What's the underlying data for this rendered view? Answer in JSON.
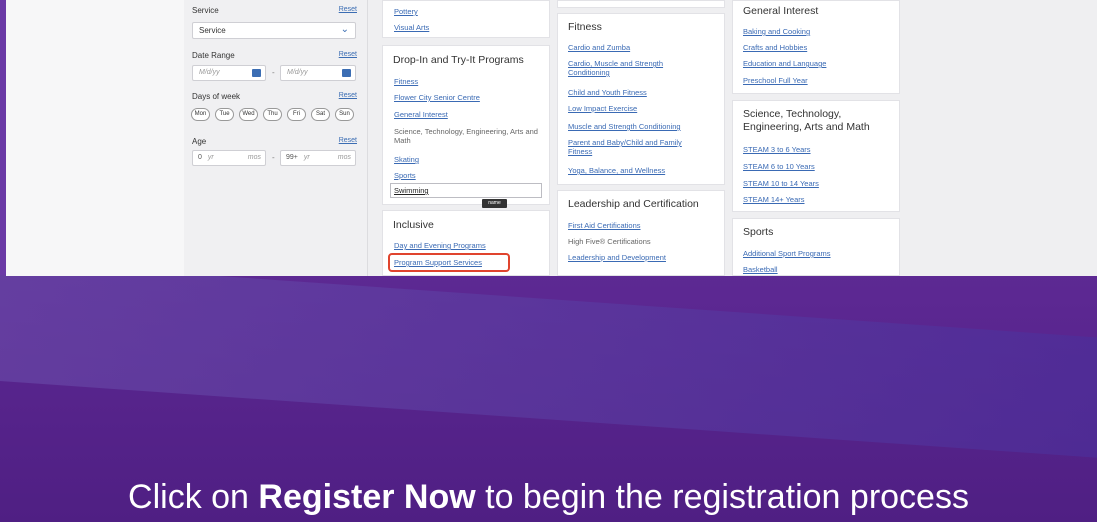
{
  "filters": {
    "service": {
      "label": "Service",
      "reset": "Reset",
      "value": "Service"
    },
    "date_range": {
      "label": "Date Range",
      "reset": "Reset",
      "start_placeholder": "M/d/yy",
      "end_placeholder": "M/d/yy",
      "separator": "-"
    },
    "days_of_week": {
      "label": "Days of week",
      "reset": "Reset",
      "days": [
        "Mon",
        "Tue",
        "Wed",
        "Thu",
        "Fri",
        "Sat",
        "Sun"
      ]
    },
    "age": {
      "label": "Age",
      "reset": "Reset",
      "min_value": "0",
      "min_unit": "yr",
      "min_unit2": "mos",
      "separator": "-",
      "max_value": "99+",
      "max_unit": "yr",
      "max_unit2": "mos"
    }
  },
  "top_card": {
    "links": [
      "Pottery",
      "Visual Arts"
    ]
  },
  "drop_in": {
    "title": "Drop-In and Try-It Programs",
    "links": [
      "Fitness",
      "Flower City Senior Centre",
      "General Interest"
    ],
    "plain": "Science, Technology, Engineering, Arts and Math",
    "links2": [
      "Skating",
      "Sports"
    ],
    "input_value": "Swimming",
    "tooltip": "name"
  },
  "inclusive": {
    "title": "Inclusive",
    "links": [
      "Day and Evening Programs",
      "Program Support Services"
    ]
  },
  "fitness": {
    "title": "Fitness",
    "links": [
      "Cardio and Zumba",
      "Cardio, Muscle and Strength Conditioning",
      "Child and Youth Fitness",
      "Low Impact Exercise",
      "Muscle and Strength Conditioning",
      "Parent and Baby/Child and Family Fitness",
      "Yoga, Balance, and Wellness"
    ]
  },
  "leadership": {
    "title": "Leadership and Certification",
    "items": [
      "First Aid Certifications",
      "High Five® Certifications",
      "Leadership and Development"
    ]
  },
  "general_interest": {
    "title": "General Interest",
    "links": [
      "Baking and Cooking",
      "Crafts and Hobbies",
      "Education and Language",
      "Preschool Full Year"
    ]
  },
  "steam": {
    "title": "Science, Technology, Engineering, Arts and Math",
    "links": [
      "STEAM 3 to 6 Years",
      "STEAM 6 to 10 Years",
      "STEAM 10 to 14 Years",
      "STEAM 14+ Years"
    ]
  },
  "sports": {
    "title": "Sports",
    "links": [
      "Additional Sport Programs",
      "Basketball"
    ]
  },
  "caption": {
    "prefix": "Click on ",
    "bold": "Register Now",
    "suffix": " to begin the registration process"
  },
  "colors": {
    "accent": "#3a6ab4",
    "highlight": "#e0442e",
    "purple": "#5b2791"
  }
}
